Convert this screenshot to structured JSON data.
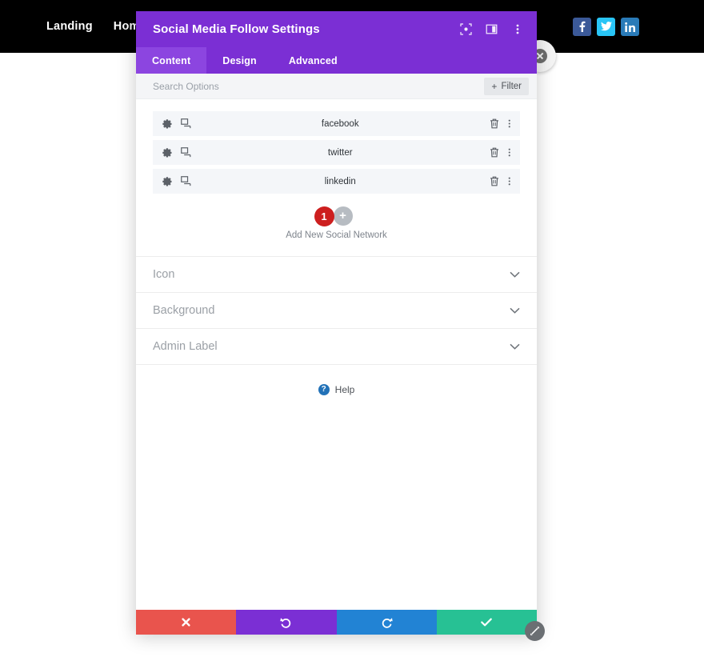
{
  "site": {
    "nav": [
      {
        "label": "Landing"
      },
      {
        "label": "Home"
      }
    ],
    "social": [
      {
        "name": "facebook",
        "glyph": "f",
        "color": "#3b5998"
      },
      {
        "name": "twitter",
        "glyph": "t",
        "color": "#29c5f6"
      },
      {
        "name": "linkedin",
        "glyph": "in",
        "color": "#2a7bb8"
      }
    ]
  },
  "modal": {
    "title": "Social Media Follow Settings",
    "title_icons": [
      {
        "name": "fullscreen-icon"
      },
      {
        "name": "layout-panel-icon"
      },
      {
        "name": "more-vertical-icon"
      }
    ],
    "tabs": [
      {
        "label": "Content",
        "active": true
      },
      {
        "label": "Design",
        "active": false
      },
      {
        "label": "Advanced",
        "active": false
      }
    ],
    "search": {
      "placeholder": "Search Options",
      "value": ""
    },
    "filter_label": "Filter",
    "filter_plus": "+",
    "networks": [
      {
        "name": "facebook"
      },
      {
        "name": "twitter"
      },
      {
        "name": "linkedin"
      }
    ],
    "add": {
      "badge": "1",
      "plus": "+",
      "label": "Add New Social Network"
    },
    "accordions": [
      {
        "label": "Icon"
      },
      {
        "label": "Background"
      },
      {
        "label": "Admin Label"
      }
    ],
    "help": {
      "icon_char": "?",
      "label": "Help"
    },
    "actions": [
      {
        "name": "cancel",
        "color": "#e9544d"
      },
      {
        "name": "undo",
        "color": "#7b2fd4"
      },
      {
        "name": "redo",
        "color": "#2283d4"
      },
      {
        "name": "save",
        "color": "#27c194"
      }
    ]
  },
  "colors": {
    "modal_header": "#7b2fd4",
    "tab_active": "#8c45e0",
    "badge_red": "#cd1f1f",
    "site_header": "#000000"
  }
}
